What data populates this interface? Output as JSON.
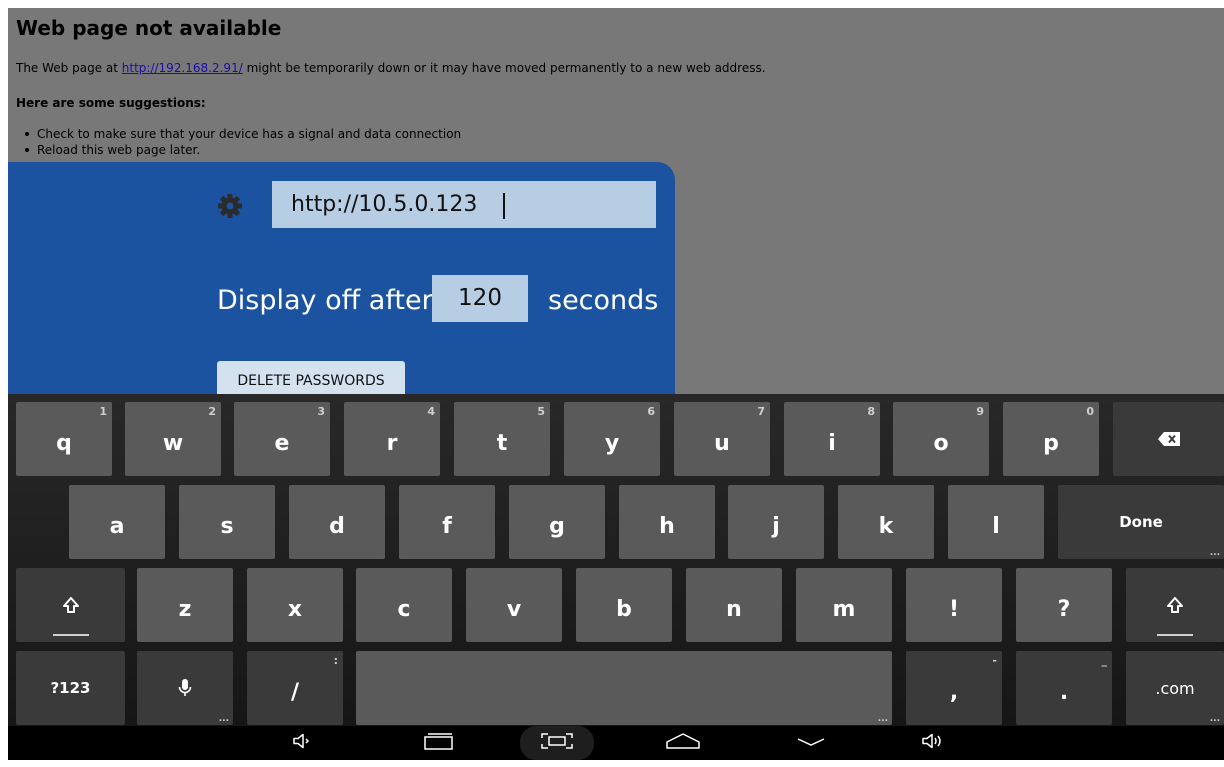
{
  "webpage": {
    "title": "Web page not available",
    "para_prefix": "The Web page at ",
    "url_link": "http://192.168.2.91/",
    "para_suffix": " might be temporarily down or it may have moved permanently to a new web address.",
    "suggestions_heading": "Here are some suggestions:",
    "suggestions": [
      "Check to make sure that your device has a signal and data connection",
      "Reload this web page later."
    ]
  },
  "settings": {
    "server_url": "http://10.5.0.123",
    "display_off_label": "Display off after",
    "display_off_seconds": "120",
    "seconds_label": "seconds",
    "delete_passwords_label": "DELETE PASSWORDS"
  },
  "keyboard": {
    "row1": [
      {
        "key": "q",
        "hint": "1"
      },
      {
        "key": "w",
        "hint": "2"
      },
      {
        "key": "e",
        "hint": "3"
      },
      {
        "key": "r",
        "hint": "4"
      },
      {
        "key": "t",
        "hint": "5"
      },
      {
        "key": "y",
        "hint": "6"
      },
      {
        "key": "u",
        "hint": "7"
      },
      {
        "key": "i",
        "hint": "8"
      },
      {
        "key": "o",
        "hint": "9"
      },
      {
        "key": "p",
        "hint": "0"
      }
    ],
    "row2": [
      "a",
      "s",
      "d",
      "f",
      "g",
      "h",
      "j",
      "k",
      "l"
    ],
    "done_label": "Done",
    "row3": [
      "z",
      "x",
      "c",
      "v",
      "b",
      "n",
      "m",
      "!",
      "?"
    ],
    "symbols_label": "?123",
    "slash_label": "/",
    "slash_hint": ":",
    "comma_label": ",",
    "comma_hint": "-",
    "period_label": ".",
    "period_hint": "_",
    "dotcom_label": ".com",
    "more_dots": "...",
    "icons": {
      "backspace": "backspace-icon",
      "shift": "shift-icon",
      "mic": "mic-icon",
      "settings": "gear-icon"
    }
  },
  "navbar": {
    "icons": [
      "volume-down-icon",
      "recent-apps-icon",
      "screenshot-icon",
      "home-icon",
      "hide-keyboard-icon",
      "volume-up-icon"
    ]
  },
  "colors": {
    "panel_blue": "#1b53a0",
    "input_bg": "#b6cde3",
    "key_bg": "#5a5a5a",
    "page_bg": "#787878"
  }
}
